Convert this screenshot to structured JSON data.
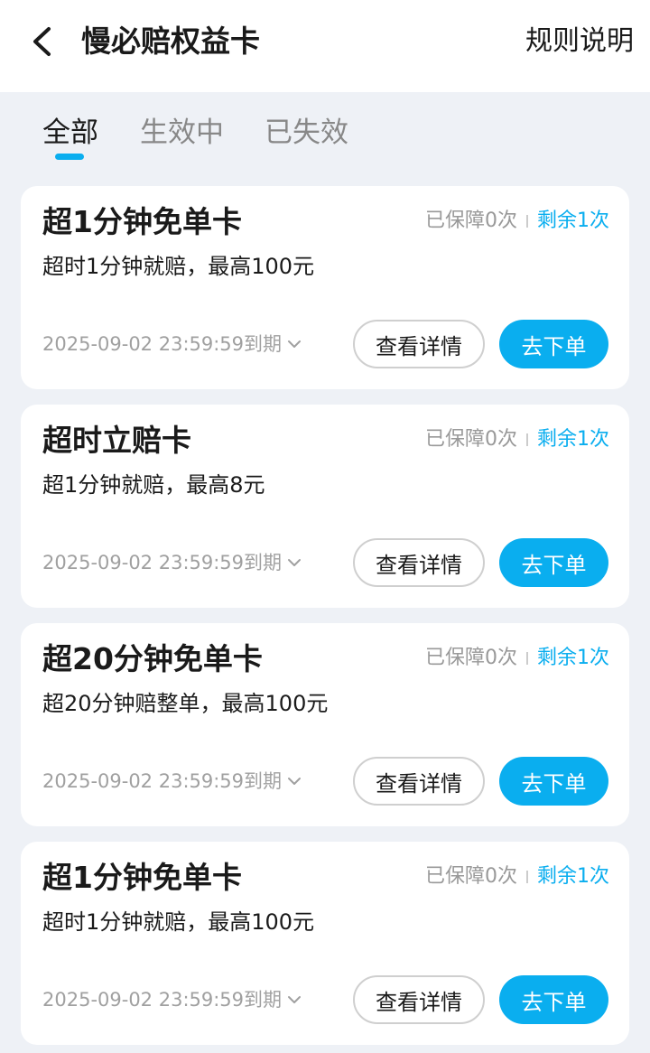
{
  "header": {
    "title": "慢必赔权益卡",
    "rules_label": "规则说明",
    "back_icon": "chevron-left-icon"
  },
  "tabs": [
    {
      "label": "全部",
      "active": true
    },
    {
      "label": "生效中",
      "active": false
    },
    {
      "label": "已失效",
      "active": false
    }
  ],
  "colors": {
    "accent": "#0aaeef",
    "background": "#eef1f6",
    "card": "#ffffff"
  },
  "cards": [
    {
      "title": "超1分钟免单卡",
      "description": "超时1分钟就赔，最高100元",
      "used": "已保障0次",
      "remaining": "剩余1次",
      "expiry": "2025-09-02 23:59:59到期",
      "detail_label": "查看详情",
      "order_label": "去下单"
    },
    {
      "title": "超时立赔卡",
      "description": "超1分钟就赔，最高8元",
      "used": "已保障0次",
      "remaining": "剩余1次",
      "expiry": "2025-09-02 23:59:59到期",
      "detail_label": "查看详情",
      "order_label": "去下单"
    },
    {
      "title": "超20分钟免单卡",
      "description": "超20分钟赔整单，最高100元",
      "used": "已保障0次",
      "remaining": "剩余1次",
      "expiry": "2025-09-02 23:59:59到期",
      "detail_label": "查看详情",
      "order_label": "去下单"
    },
    {
      "title": "超1分钟免单卡",
      "description": "超时1分钟就赔，最高100元",
      "used": "已保障0次",
      "remaining": "剩余1次",
      "expiry": "2025-09-02 23:59:59到期",
      "detail_label": "查看详情",
      "order_label": "去下单"
    }
  ]
}
